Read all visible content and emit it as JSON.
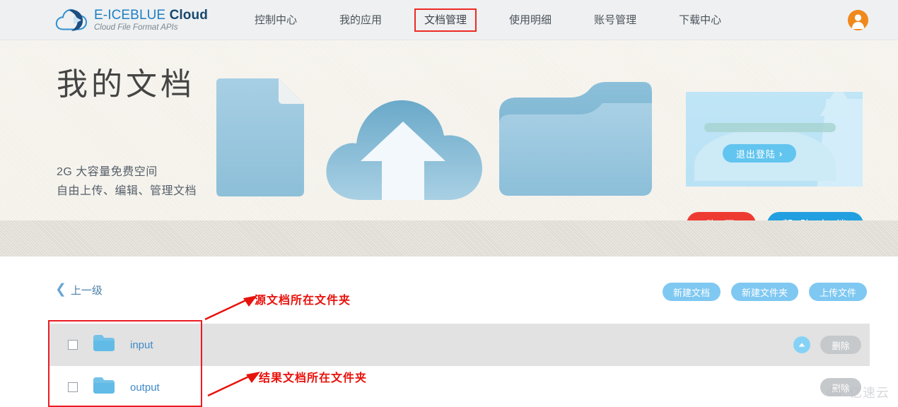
{
  "header": {
    "logo": {
      "icon": "cloud-logo-icon",
      "title_light": "E-ICEBLUE ",
      "title_bold": "Cloud",
      "subtitle": "Cloud File Format APIs"
    },
    "nav": [
      {
        "label": "控制中心",
        "active": false
      },
      {
        "label": "我的应用",
        "active": false
      },
      {
        "label": "文档管理",
        "active": true
      },
      {
        "label": "使用明细",
        "active": false
      },
      {
        "label": "账号管理",
        "active": false
      },
      {
        "label": "下载中心",
        "active": false
      }
    ],
    "avatar_icon": "user-avatar-icon",
    "accent_color": "#1f7fc4",
    "active_outline_color": "#ee2a24"
  },
  "hero": {
    "title": "我的文档",
    "subtitle_line1": "2G 大容量免费空间",
    "subtitle_line2": "自由上传、编辑、管理文档",
    "art": [
      "document-icon",
      "cloud-upload-icon",
      "folder-icon"
    ],
    "logout_button": "退出登陆",
    "logout_chevron": "›",
    "buy_button": "购 买",
    "help_button": "帮 助 文 档",
    "buy_color": "#ee3b32",
    "help_color": "#229fe0"
  },
  "main": {
    "back_link": "上一级",
    "toolbar": [
      {
        "label": "新建文档"
      },
      {
        "label": "新建文件夹"
      },
      {
        "label": "上传文件"
      }
    ],
    "files": [
      {
        "name": "input",
        "icon": "folder-icon",
        "selected": true,
        "delete_label": "删除",
        "has_upload_bubble": true
      },
      {
        "name": "output",
        "icon": "folder-icon",
        "selected": false,
        "delete_label": "删除",
        "has_upload_bubble": false
      }
    ],
    "delete_label": "删除"
  },
  "annotations": {
    "color": "#e8120c",
    "source_folder_note": "源文档所在文件夹",
    "result_folder_note": "结果文档所在文件夹"
  },
  "watermark": {
    "text": "亿速云",
    "icon": "cloud-watermark-icon"
  }
}
